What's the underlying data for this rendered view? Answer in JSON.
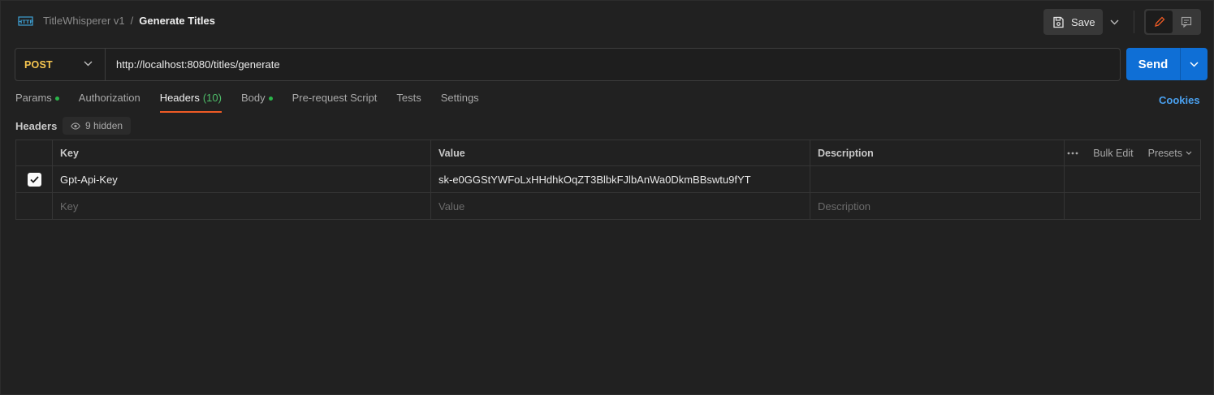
{
  "breadcrumb": {
    "collection": "TitleWhisperer v1",
    "separator": "/",
    "request_name": "Generate Titles"
  },
  "toolbar": {
    "save_label": "Save"
  },
  "request": {
    "method": "POST",
    "url": "http://localhost:8080/titles/generate",
    "send_label": "Send"
  },
  "tabs": [
    {
      "label": "Params",
      "dot": true
    },
    {
      "label": "Authorization"
    },
    {
      "label": "Headers",
      "count": "(10)",
      "active": true
    },
    {
      "label": "Body",
      "dot": true
    },
    {
      "label": "Pre-request Script"
    },
    {
      "label": "Tests"
    },
    {
      "label": "Settings"
    }
  ],
  "cookies_label": "Cookies",
  "headers_section": {
    "title": "Headers",
    "hidden_label": "9 hidden"
  },
  "table": {
    "columns": {
      "key": "Key",
      "value": "Value",
      "description": "Description"
    },
    "actions": {
      "bulk_edit": "Bulk Edit",
      "presets": "Presets"
    },
    "rows": [
      {
        "checked": true,
        "key": "Gpt-Api-Key",
        "value": "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",
        "description": ""
      }
    ],
    "placeholders": {
      "key": "Key",
      "value": "Value",
      "description": "Description"
    }
  },
  "colors": {
    "accent_send": "#0f6fd6",
    "method_post": "#f5c550",
    "active_tab_underline": "#ef5b25",
    "status_dot": "#2bb54a",
    "link": "#4aa1f0"
  }
}
